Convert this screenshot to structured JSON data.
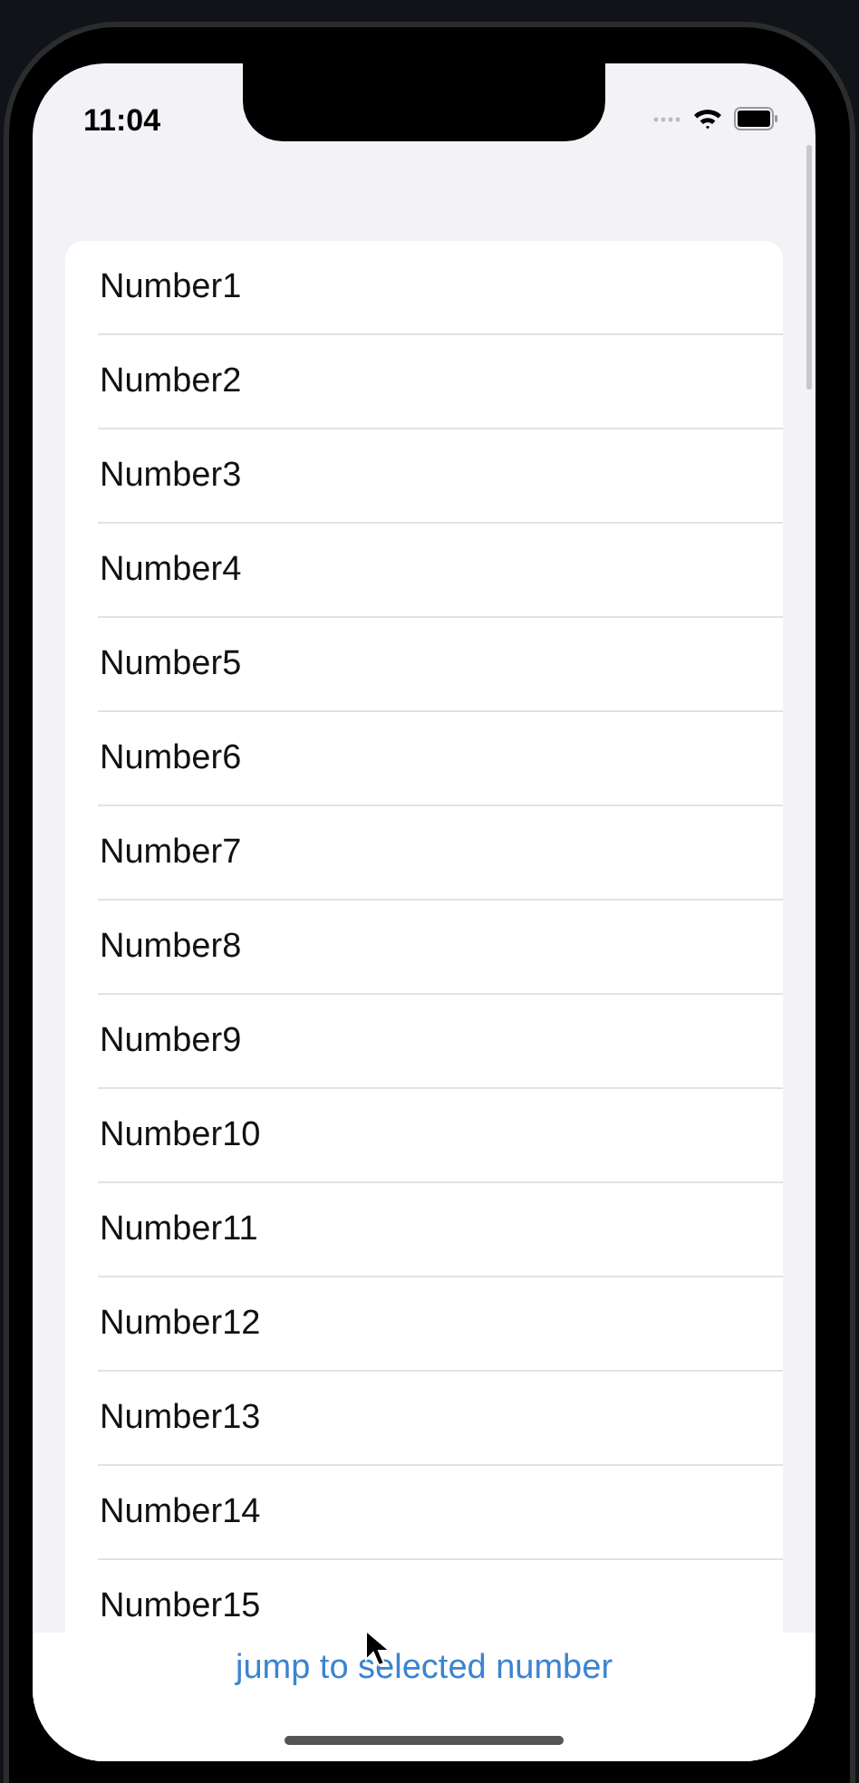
{
  "status_bar": {
    "time": "11:04"
  },
  "list": {
    "items": [
      {
        "label": "Number1"
      },
      {
        "label": "Number2"
      },
      {
        "label": "Number3"
      },
      {
        "label": "Number4"
      },
      {
        "label": "Number5"
      },
      {
        "label": "Number6"
      },
      {
        "label": "Number7"
      },
      {
        "label": "Number8"
      },
      {
        "label": "Number9"
      },
      {
        "label": "Number10"
      },
      {
        "label": "Number11"
      },
      {
        "label": "Number12"
      },
      {
        "label": "Number13"
      },
      {
        "label": "Number14"
      },
      {
        "label": "Number15"
      }
    ]
  },
  "bottom_bar": {
    "button": "jump to selected number"
  }
}
